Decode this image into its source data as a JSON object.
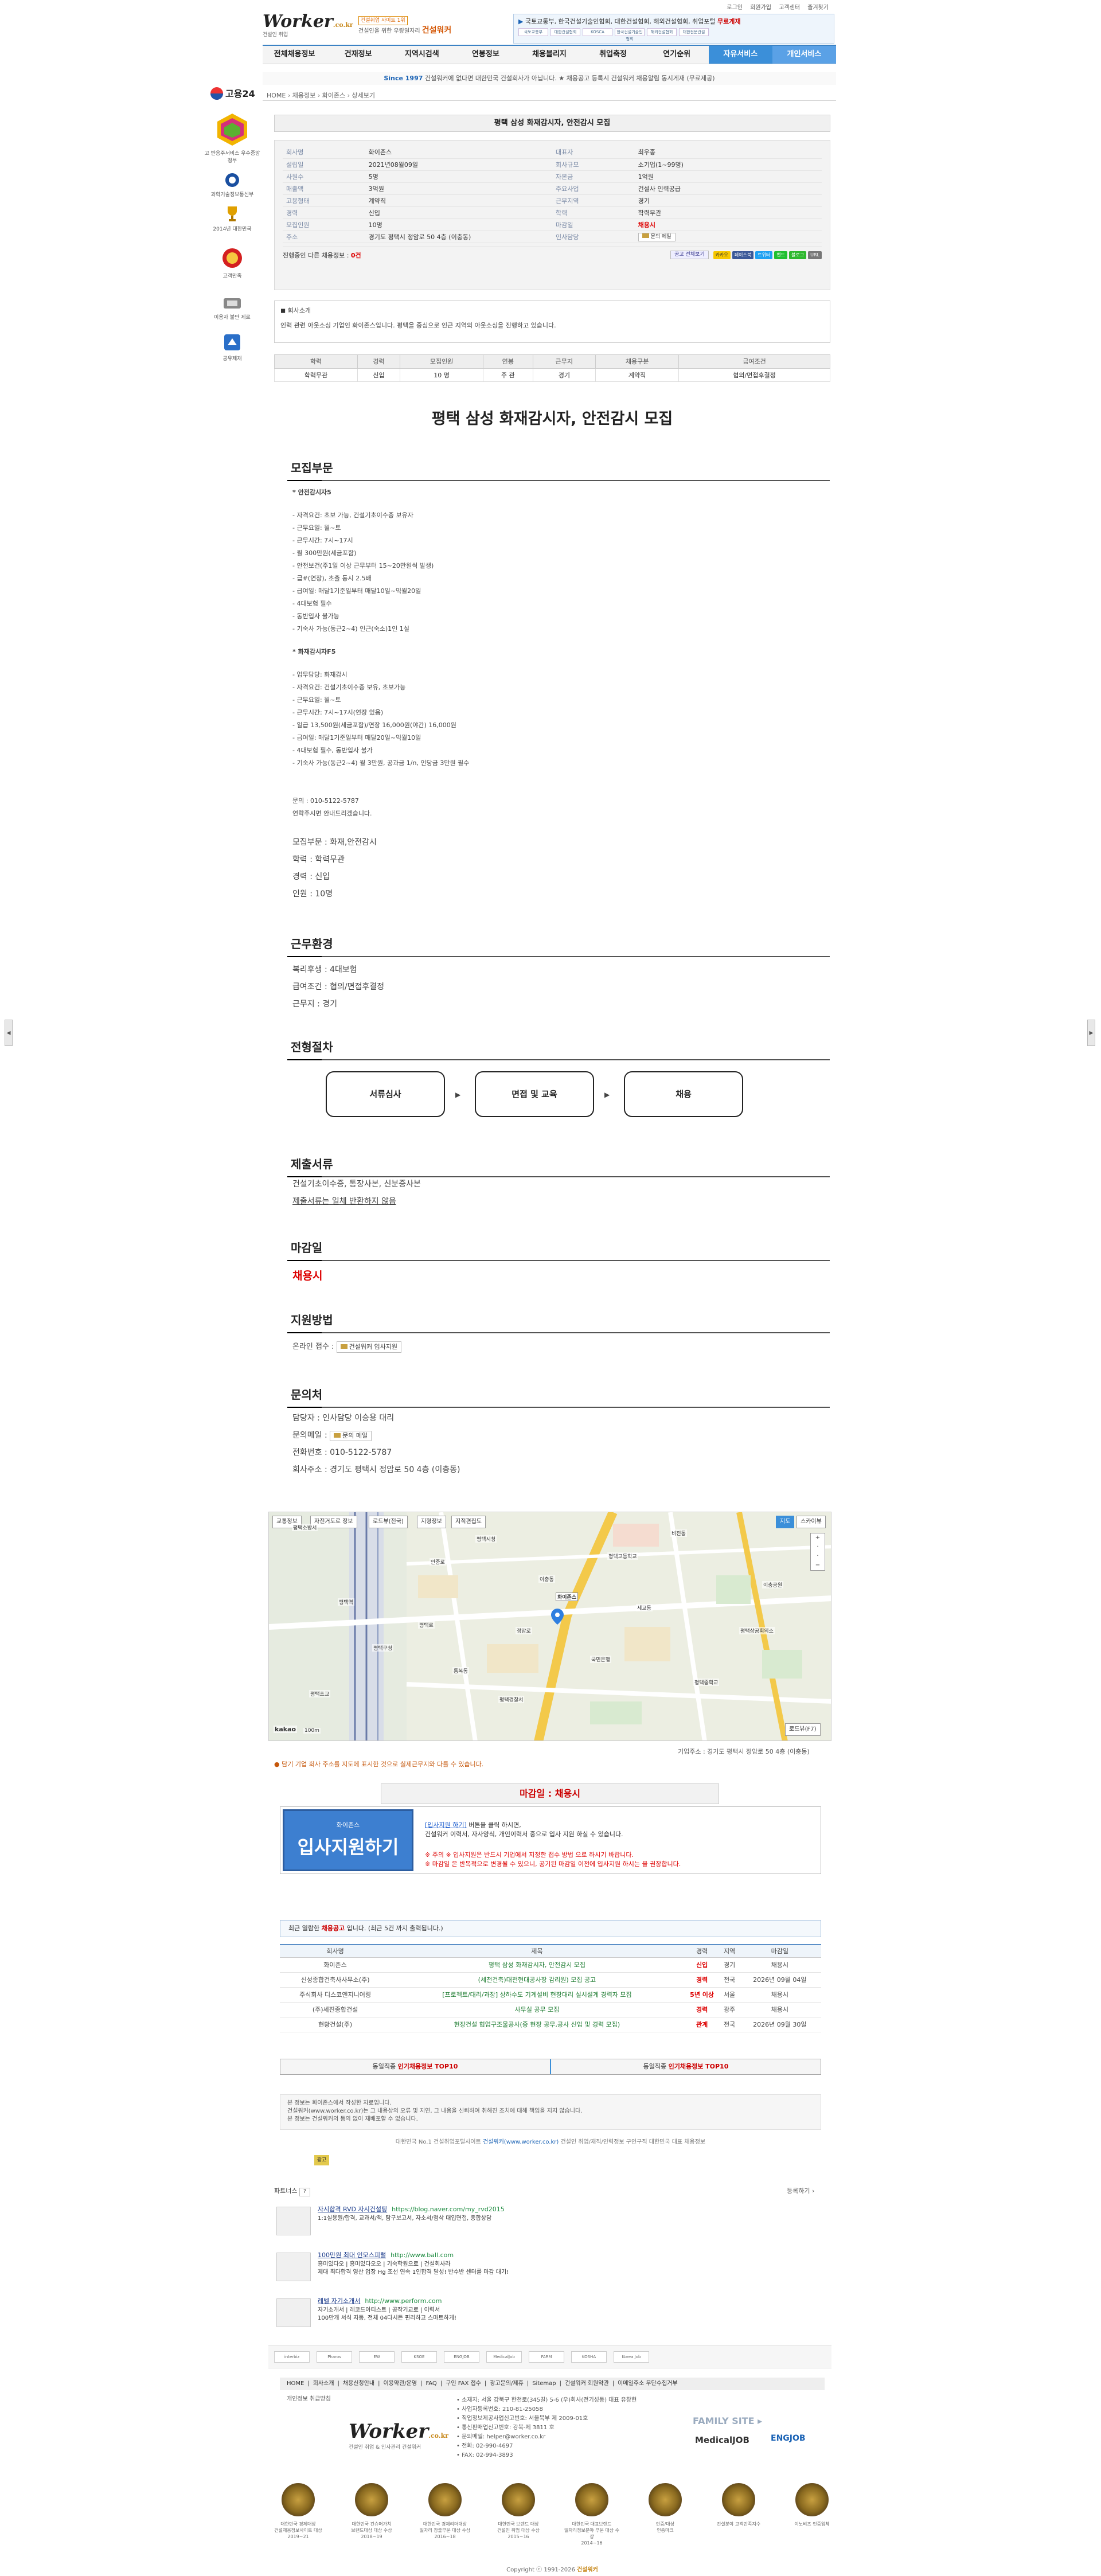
{
  "util": [
    "로그인",
    "회원가입",
    "고객센터",
    "즐겨찾기"
  ],
  "header": {
    "logo_mark": "Worker",
    "logo_domain": ".co.kr",
    "logo_sub": "건설인 취업",
    "slogan_tag": "건설취업 사이트 1위",
    "slogan_line1": "건설인을 위한 우량일자리",
    "slogan_brand": "건설워커",
    "notice": "국토교통부, 한국건설기술인협회, 대한건설협회, 해외건설협회, 취업포털",
    "notice_hl": "무료게재",
    "notice_logos": [
      "국토교통부",
      "대한건설협회",
      "KOSCA",
      "한국건설기술인협회",
      "해외건설협회",
      "대한전문건설"
    ]
  },
  "gnb": [
    "전체채용정보",
    "건재정보",
    "지역시검색",
    "연봉정보",
    "채용블리지",
    "취업축정",
    "연기순위",
    "자유서비스",
    "개인서비스"
  ],
  "since": {
    "year": "Since 1997",
    "text": "건설워커에 없다면 대한민국 건설회사가 아닙니다. ★ 채용공고 등록시 건설워커 채용알림 동시게재 (무료제공)"
  },
  "breadcrumb": "HOME › 채용정보 › 화이존스 › 상세보기",
  "side": [
    {
      "name": "고용24",
      "sub": ""
    },
    {
      "name": "전문건설 정부 지원",
      "sub": "고 반응주서비스 우수중앙정부"
    },
    {
      "name": "과학기술정보통신부",
      "sub": ""
    },
    {
      "name": "2014년 대한민국",
      "sub": "국가브랜드 대상"
    },
    {
      "name": "고객만족",
      "sub": "건설분야 만족지수"
    },
    {
      "name": "이용자 불만 제로",
      "sub": "안전한 검증업체"
    },
    {
      "name": "고용노동부",
      "sub": "공유제재"
    }
  ],
  "job": {
    "title": "평택 삼성 화재감시자, 안전감시 모집",
    "info_rows": [
      {
        "k1": "회사명",
        "v1": "화이존스",
        "k2": "대표자",
        "v2": "최우종"
      },
      {
        "k1": "설립일",
        "v1": "2021년08월09일",
        "k2": "회사규모",
        "v2": "소기업(1~99명)"
      },
      {
        "k1": "사원수",
        "v1": "5명",
        "k2": "자본금",
        "v2": "1억원"
      },
      {
        "k1": "매출액",
        "v1": "3억원",
        "k2": "주요사업",
        "v2": "건설사 인력공급"
      },
      {
        "k1": "고용형태",
        "v1": "계약직",
        "k2": "근무지역",
        "v2": "경기"
      },
      {
        "k1": "경력",
        "v1": "신입",
        "k2": "학력",
        "v2": "학력무관"
      },
      {
        "k1": "모집인원",
        "v1": "10명",
        "k2": "마감일",
        "v2": "채용시"
      },
      {
        "k1": "주소",
        "v1": "경기도 평택시 정암로 50 4층 (이충동)",
        "k2": "인사담당",
        "v2": "문의 메일"
      }
    ],
    "footer_label": "진행중인 다른 채용정보 : ",
    "footer_count": "0건",
    "footer_btn": "공고 전체보기",
    "sns": [
      "카카오",
      "페이스북",
      "트위터",
      "밴드",
      "블로그",
      "URL"
    ]
  },
  "intro": {
    "heading": "회사소개",
    "text": "인력 관련 아웃소싱 기업인 화이존스입니다. 평택을 중심으로 인근 지역의 아웃소싱을 진행하고 있습니다."
  },
  "summary": {
    "headers": [
      "학력",
      "경력",
      "모집인원",
      "연봉",
      "근무지",
      "채용구분",
      "급여조건"
    ],
    "row": [
      "학력무관",
      "신입",
      "10 명",
      "주 관",
      "경기",
      "계약직",
      "협의/면접후결정"
    ]
  },
  "main_title": "평택 삼성 화재감시자, 안전감시 모집",
  "sections": {
    "recruit": "모집부문",
    "work_env": "근무환경",
    "process": "전형절차",
    "docs": "제출서류",
    "deadline": "마감일",
    "apply": "지원방법",
    "contact": "문의처"
  },
  "recruit": {
    "safety_h": "* 안전감시자5",
    "safety_items": [
      "- 자격요건: 초보 가능, 건설기초이수증 보유자",
      "- 근무요일: 월~토",
      "- 근무시간: 7시~17시",
      "- 월 300만원(세금포함)",
      "- 안전보건(주1일 이상 근무부터 15~20만원씩 발생)",
      "- 급#(연장), 초출 동시 2.5배",
      "- 급여일: 매달1기준일부터 매달10일~익월20일",
      "- 4대보험 필수",
      "- 동반입사 불가능",
      "- 기숙사 가능(동근2~4) 인근(숙소)1인 1실"
    ],
    "fire_h": "* 화재감시자F5",
    "fire_items": [
      "- 업무담당: 화재감시",
      "- 자격요건: 건설기초이수증 보유, 초보가능",
      "- 근무요일: 월~토",
      "- 근무시간: 7시~17시(연장 있음)",
      "- 일급 13,500원(세금포함)/연장 16,000원(야간) 16,000원",
      "- 급여일: 매달1기준일부터 매달20일~익월10일",
      "- 4대보험 필수, 동반입사 불가",
      "- 기숙사 가능(동근2~4) 월 3만원, 공과금 1/n, 인당금 3만원 필수"
    ],
    "contact_lines": [
      "문의 : 010-5122-5787",
      "연락주시면 안내드리겠습니다."
    ],
    "summary_lines": [
      "모집부문 : 화재,안전감시",
      "학력 : 학력무관",
      "경력 : 신입",
      "인원 : 10명"
    ]
  },
  "work_env": [
    "복리후생 : 4대보험",
    "급여조건 : 협의/면접후결정",
    "근무지 : 경기"
  ],
  "process_steps": [
    "서류심사",
    "면접 및 교육",
    "채용"
  ],
  "docs": {
    "line1": "건설기초이수증, 통장사본, 신분증사본",
    "line2": "제출서류는 일체 반환하지 않음"
  },
  "deadline_value": "채용시",
  "apply_method": {
    "label": "온라인 접수 : ",
    "btn": "건설워커 입사지원"
  },
  "contact": {
    "manager": "담당자 : 인사담당 이승용 대리",
    "mail_label": "문의메일 : ",
    "mail_btn": "문의 메일",
    "phone": "전화번호 : 010-5122-5787",
    "address": "회사주소 : 경기도 평택시 정암로 50 4층 (이충동)"
  },
  "map": {
    "toolbar": [
      "교통정보",
      "자전거도로 정보",
      "로드뷰(전국)",
      "지형정보",
      "지적편집도"
    ],
    "view": [
      "지도",
      "스카이뷰"
    ],
    "labels": [
      "평택소방서",
      "평택시청",
      "평택역",
      "이충동",
      "정암로",
      "비전동",
      "평택고등학교",
      "안중로",
      "화이존스",
      "세교동",
      "평택구청",
      "통복동",
      "평택초교",
      "평택상공회의소",
      "평택중학교",
      "국민은행",
      "평택경찰서",
      "평택로",
      "이충공원"
    ],
    "brand": "kakao",
    "scale": "100m",
    "roadview": "로드뷰(F7)"
  },
  "map_addr": "기업주소 : 경기도 평택시 정암로 50 4층 (이충동)",
  "warn": "담기 기업 회사 주소를 지도에 표시한 것으로 실제근무지와 다를 수 있습니다.",
  "deadline_bar": "마감일 : 채용시",
  "apply": {
    "btn_small": "화이존스",
    "btn_big": "입사지원하기",
    "desc1_pre": "[입사지원 하기]",
    "desc1": " 버튼을 클릭 하시면,",
    "desc2": "건설워커 이력서, 자사양식, 개인이력서 중으로 입사 지원 하실 수 있습니다.",
    "note1": "※ 주의  ※ 입사지원은 반드시 기업에서 지정한 접수 방법 으로 하시기 바랍니다.",
    "note2": "※ 마감일 은 반복적으로 변경될 수 있으니, 공기된 마감일 이전에 입사지원 하시는 을 권장합니다."
  },
  "recent": {
    "heading_pre": "최근 열람한 ",
    "heading_hl": "채용공고",
    "heading_post": " 입니다. (최근 5건 까지 출력됩니다.)",
    "headers": [
      "회사명",
      "제목",
      "경력",
      "지역",
      "마감일"
    ],
    "rows": [
      [
        "화이존스",
        "평택 삼성 화재감시자, 안전감시 모집",
        "신입",
        "경기",
        "채용시"
      ],
      [
        "신성종합건축사사무소(주)",
        "(세천건축)대전현대공사장 감리원) 모집 공고",
        "경력",
        "전국",
        "2026년 09월 04일"
      ],
      [
        "주식회사 디스코엔지니어링",
        "[프로젝트/대리/과장] 상하수도 기계설비 현장대리 실시설계 경력자 모집",
        "5년 이상",
        "서울",
        "채용시"
      ],
      [
        "(주)세진종합건설",
        "사무실 공무 모집",
        "경력",
        "광주",
        "채용시"
      ],
      [
        "현황건설(주)",
        "현장건설 협업구조물공사(중 현장 공무,공사 신입 및 경력 모집)",
        "관계",
        "전국",
        "2026년 09월 30일"
      ]
    ]
  },
  "top10": {
    "a_pre": "동일직종 ",
    "a_hl": "인기채용정보 TOP10",
    "b_pre": "동일직종 ",
    "b_hl": "인기채용정보 TOP10"
  },
  "disclaimer": [
    "본 정보는 화이존스에서 작성한 자료입니다.",
    "건설워커(www.worker.co.kr)는 그 내용상의 오류 및 지연, 그 내용을 신뢰하여 취해진 조치에 대해 책임을 지지 않습니다.",
    "본 정보는 건설워커의 동의 없이 재배포할 수 없습니다."
  ],
  "copyline_pre": "대한민국 No.1 건설취업포털사이트 ",
  "copyline_hl": "건설워커(www.worker.co.kr)",
  "copyline_post": " 건설인 취업/재직/인력정보 구인구직 대한민국 대표 채용정보",
  "ad_label": "광고",
  "partners": {
    "heading": "파트너스",
    "more": "등록하기 ›",
    "items": [
      {
        "title": "자시합격 RVD 자시건설팅",
        "url": "https://blog.naver.com/my_rvd2015",
        "desc": "1:1실용원/합격, 교과서/책, 탐구보고서, 자소서/첨삭 대입면접, 종합상담"
      },
      {
        "title": "100만원 최대 인모스피럴",
        "url": "http://www.ball.com",
        "desc": "흥미있다오 | 흥미있다오오 | 기숙학원으로 | 건설회사라\n제대 최다합격 영산 업장 Hg 조선 연속 1인합격 달성! 반수반 센터를 마감 대기!"
      },
      {
        "title": "레벨 자기소개서",
        "url": "http://www.perform.com",
        "desc": "자기소개서 | 레코드아티스트 | 공작기교로 | 이력서\n100만개 서식 자동, 전체 04다시든 편리하고 스마트하게!"
      }
    ]
  },
  "family_logos": [
    "interbiz",
    "Pharos",
    "EW",
    "KSOE",
    "ENGJOB",
    "MedicalJob",
    "FARM",
    "KOSHA",
    "Korea Job"
  ],
  "foot_menu": [
    "HOME",
    "회사소개",
    "채용신청안내",
    "이용약관/운영",
    "FAQ",
    "구인 FAX 접수",
    "광고문의/제휴",
    "Sitemap",
    "건설워커 회원약관",
    "이메일주소 무단수집거부"
  ],
  "privacy": "개인정보 취급방침",
  "foot_logo_sub": "건설인 취업 & 인사관리 건설워커",
  "foot_info": [
    "• 소재지: 서울 강북구 한천로(345길) 5-6 (우)회사(전기성동) 대표 유창현",
    "• 사업자등록번호: 210-81-25058",
    "• 직업정보제공사업신고번호: 서울북부 제 2009-01호",
    "• 통신판매업신고번호: 강북-제 3811 호",
    "• 문의메일: helper@worker.co.kr",
    "• 전화: 02-990-4697",
    "• FAX: 02-994-3893"
  ],
  "family_site": "FAMILY SITE ▸",
  "family_site_med": "MedicalJOB",
  "family_site_eng": "ENGJOB",
  "awards": [
    {
      "l1": "대한민국 경제대상",
      "l2": "건설채용정보사이트 대상",
      "l3": "2019~21"
    },
    {
      "l1": "대한민국 컨슈머가치",
      "l2": "브랜드대상 대상 수상",
      "l3": "2018~19"
    },
    {
      "l1": "대한민국 경제리더대상",
      "l2": "일자리 창출부문 대상 수상",
      "l3": "2016~18"
    },
    {
      "l1": "대한민국 브랜드 대상",
      "l2": "건설인 취업 대상 수상",
      "l3": "2015~16"
    },
    {
      "l1": "대한민국 대표브랜드",
      "l2": "일자리정보분야 부문 대상 수상",
      "l3": "2014~16"
    },
    {
      "l1": "인증/대상",
      "l2": "인증마크",
      "l3": ""
    },
    {
      "l1": "건설분야 고객만족지수",
      "l2": "",
      "l3": ""
    },
    {
      "l1": "이노비즈 인증업체",
      "l2": "",
      "l3": ""
    }
  ],
  "copyright_pre": "Copyright ⓒ 1991-2026 ",
  "copyright_brand": "건설워커",
  "colors": {
    "accent": "#3b8fd9",
    "deadline": "#d00000",
    "brand_gold": "#c88a1e"
  }
}
